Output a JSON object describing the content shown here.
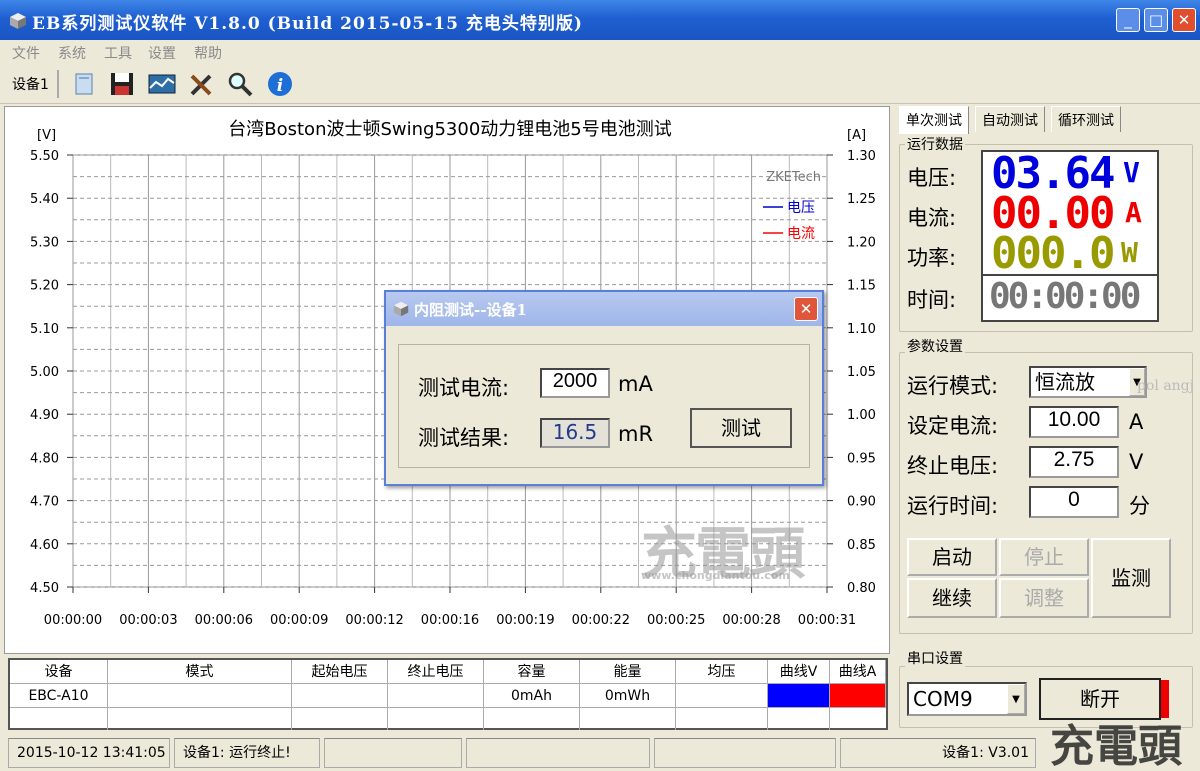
{
  "window": {
    "title": "EB系列测试仪软件 V1.8.0 (Build 2015-05-15 充电头特别版)"
  },
  "menu": [
    "文件",
    "系统",
    "工具",
    "设置",
    "帮助"
  ],
  "toolbar": {
    "device_tab": "设备1",
    "icons": [
      "open-file-icon",
      "save-icon",
      "chart-icon",
      "tools-icon",
      "search-icon",
      "info-icon"
    ]
  },
  "chart_data": {
    "type": "line",
    "title": "台湾Boston波士顿Swing5300动力锂电池5号电池测试",
    "y_left_label": "[V]",
    "y_right_label": "[A]",
    "y_left_ticks": [
      "5.50",
      "5.40",
      "5.30",
      "5.20",
      "5.10",
      "5.00",
      "4.90",
      "4.80",
      "4.70",
      "4.60",
      "4.50"
    ],
    "y_right_ticks": [
      "1.30",
      "1.25",
      "1.20",
      "1.15",
      "1.10",
      "1.05",
      "1.00",
      "0.95",
      "0.90",
      "0.85",
      "0.80"
    ],
    "x_ticks": [
      "00:00:00",
      "00:00:03",
      "00:00:06",
      "00:00:09",
      "00:00:12",
      "00:00:16",
      "00:00:19",
      "00:00:22",
      "00:00:25",
      "00:00:28",
      "00:00:31"
    ],
    "ylim_left": [
      4.5,
      5.5
    ],
    "ylim_right": [
      0.8,
      1.3
    ],
    "grid": true,
    "legend_title": "ZKETech",
    "series": [
      {
        "name": "电压",
        "color": "#0000cc",
        "values": []
      },
      {
        "name": "电流",
        "color": "#ff0000",
        "values": []
      }
    ],
    "legend_position": "top-right"
  },
  "watermark": {
    "text": "充電頭",
    "url": "www.chongdiantou.com"
  },
  "tabs": [
    "单次测试",
    "自动测试",
    "循环测试"
  ],
  "run_data": {
    "group": "运行数据",
    "voltage_label": "电压:",
    "voltage": "03.64",
    "voltage_unit": "V",
    "current_label": "电流:",
    "current": "00.00",
    "current_unit": "A",
    "power_label": "功率:",
    "power": "000.0",
    "power_unit": "W",
    "time_label": "时间:",
    "time": "00:00:00",
    "colors": {
      "voltage": "#0000dd",
      "current": "#ee0000",
      "power": "#999900",
      "time": "#777777"
    }
  },
  "params": {
    "group": "参数设置",
    "mode_label": "运行模式:",
    "mode": "恒流放",
    "current_label": "设定电流:",
    "current": "10.00",
    "current_unit": "A",
    "voltage_label": "终止电压:",
    "voltage": "2.75",
    "voltage_unit": "V",
    "time_label": "运行时间:",
    "time": "0",
    "time_unit": "分",
    "overlay_text": "pol  angj"
  },
  "buttons": {
    "start": "启动",
    "stop": "停止",
    "continue": "继续",
    "adjust": "调整",
    "monitor": "监测"
  },
  "serial": {
    "group": "串口设置",
    "port": "COM9",
    "disconnect": "断开"
  },
  "table": {
    "headers": [
      "设备",
      "模式",
      "起始电压",
      "终止电压",
      "容量",
      "能量",
      "均压",
      "曲线V",
      "曲线A"
    ],
    "row": {
      "device": "EBC-A10",
      "mode": "",
      "start_v": "",
      "end_v": "",
      "capacity": "0mAh",
      "energy": "0mWh",
      "avg": ""
    },
    "curve_colors": [
      "#0000ff",
      "#ff0000"
    ]
  },
  "status": {
    "datetime": "2015-10-12 13:41:05",
    "message": "设备1: 运行终止!",
    "version": "设备1: V3.01"
  },
  "dialog": {
    "title": "内阻测试--设备1",
    "current_label": "测试电流:",
    "current": "2000",
    "current_unit": "mA",
    "result_label": "测试结果:",
    "result": "16.5",
    "result_unit": "mR",
    "test_button": "测试"
  }
}
